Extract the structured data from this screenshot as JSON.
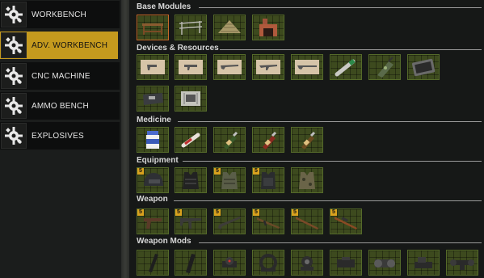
{
  "nav": {
    "items": [
      {
        "label": "WORKBENCH",
        "icon": "gear-icon",
        "active": false
      },
      {
        "label": "ADV. WORKBENCH",
        "icon": "gear-icon",
        "active": true
      },
      {
        "label": "CNC MACHINE",
        "icon": "gear-icon",
        "active": false
      },
      {
        "label": "AMMO BENCH",
        "icon": "gear-icon",
        "active": false
      },
      {
        "label": "EXPLOSIVES",
        "icon": "gear-icon",
        "active": false
      }
    ]
  },
  "categories": {
    "base_modules": {
      "title": "Base Modules"
    },
    "devices": {
      "title": "Devices & Resources"
    },
    "medicine": {
      "title": "Medicine"
    },
    "equipment": {
      "title": "Equipment",
      "badge": "5"
    },
    "weapon": {
      "title": "Weapon",
      "badge": "5"
    },
    "weapon_mods": {
      "title": "Weapon Mods"
    }
  },
  "colors": {
    "accent": "#c59a1e",
    "slot_bg": "#3d4a1e",
    "slot_border": "#556a2a",
    "selected_border": "#c76a2a"
  }
}
